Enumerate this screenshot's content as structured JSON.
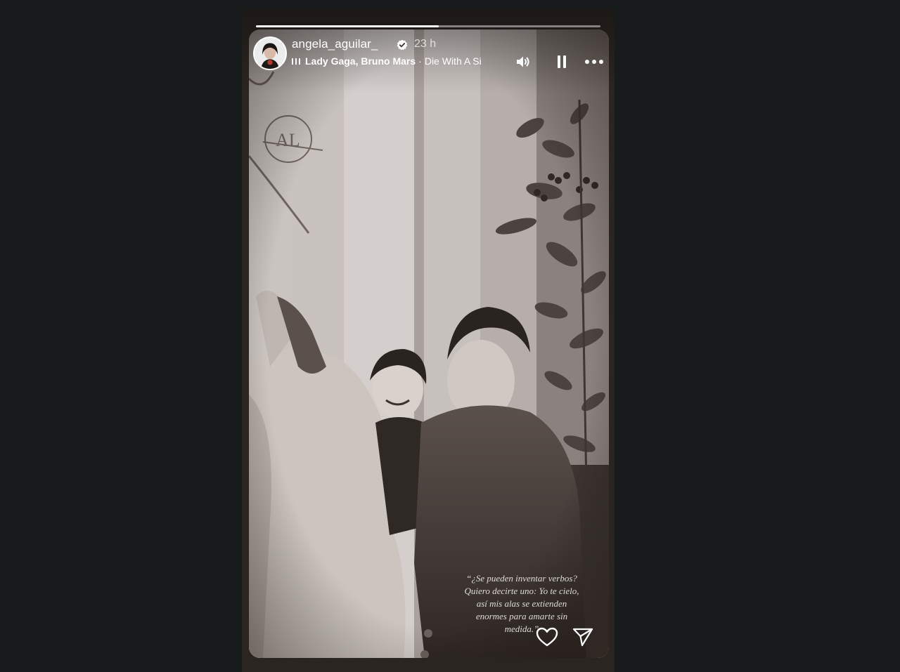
{
  "story": {
    "username": "angela_aguilar_",
    "timestamp": "23 h",
    "progress_fraction": 0.53,
    "music": {
      "artists": "Lady Gaga, Bruno Mars",
      "separator": "·",
      "song": "Die With A Si"
    },
    "caption_lines": [
      "“¿Se pueden inventar verbos?",
      "Quiero decirte uno: Yo te cielo,",
      "así mis alas se extienden",
      "enormes para amarte sin",
      "medida.”"
    ]
  },
  "icons": {
    "verified": "verified-badge-icon",
    "music": "music-bars-icon",
    "volume": "volume-icon",
    "pause": "pause-icon",
    "more": "more-options-icon",
    "like": "heart-icon",
    "share": "send-icon"
  },
  "colors": {
    "page_background": "#181b1b",
    "photo_tone": "#c9c4c1",
    "overlay_text": "#ffffff"
  }
}
